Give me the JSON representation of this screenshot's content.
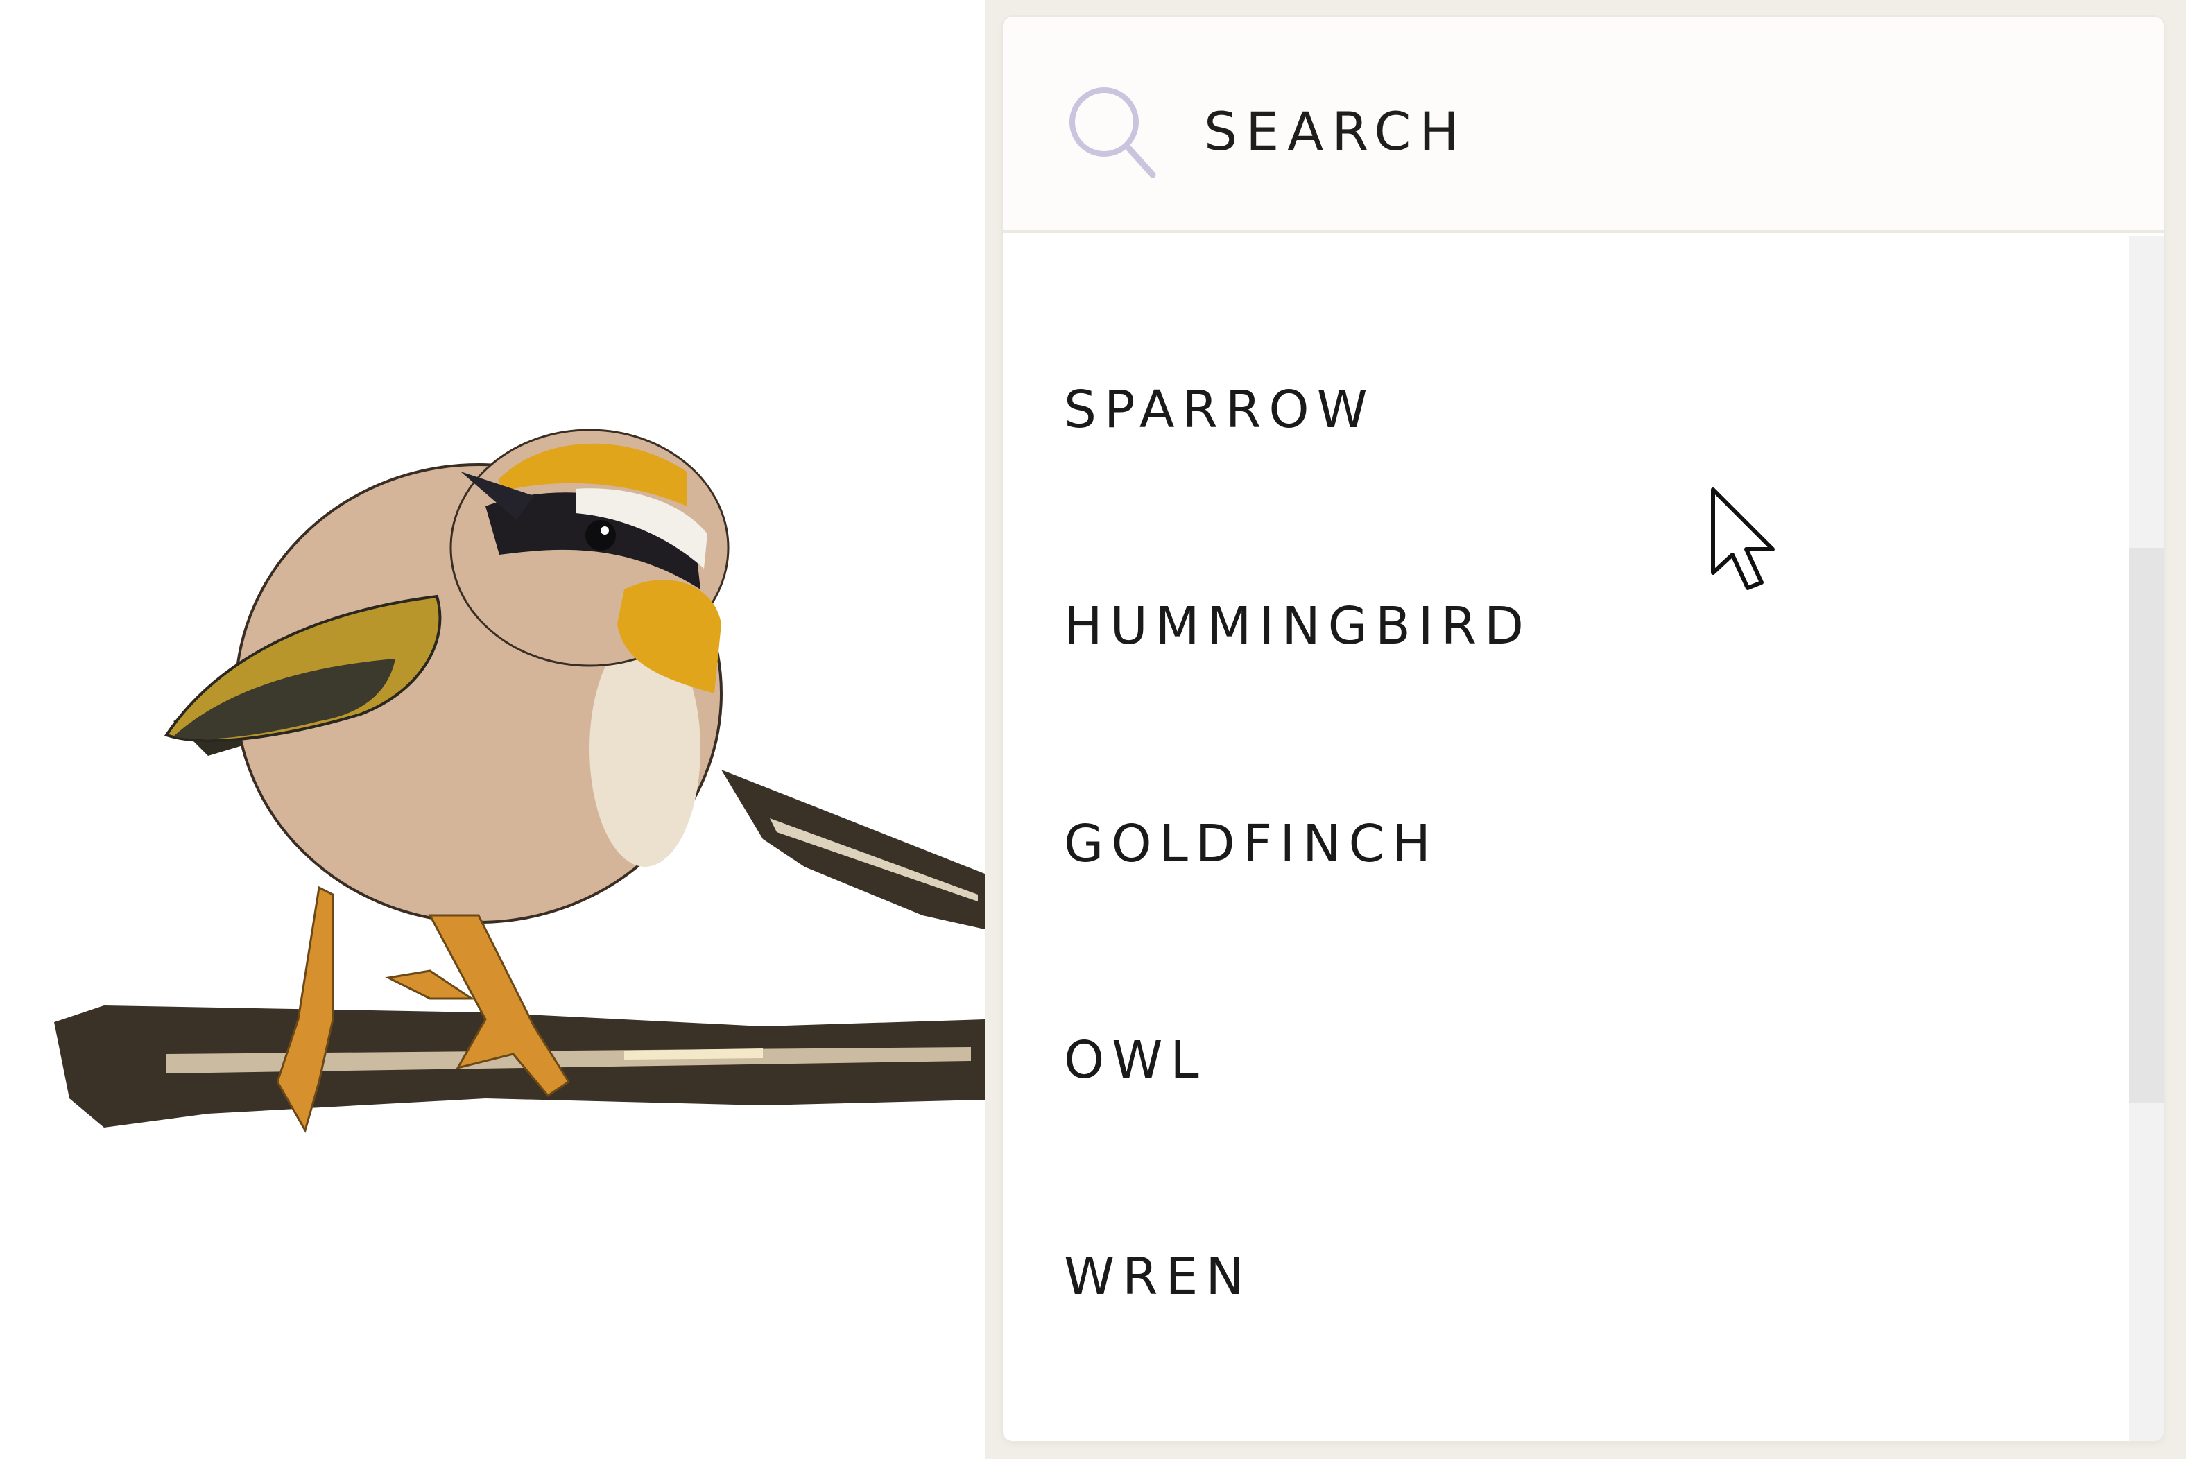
{
  "search": {
    "placeholder": "SEARCH",
    "value": ""
  },
  "list": {
    "items": [
      {
        "label": "SPARROW"
      },
      {
        "label": "HUMMINGBIRD"
      },
      {
        "label": "GOLDFINCH"
      },
      {
        "label": "OWL"
      },
      {
        "label": "WREN"
      }
    ]
  },
  "icons": {
    "search": "search-icon",
    "cursor": "mouse-pointer-icon"
  },
  "colors": {
    "side_background": "#f1ede7",
    "search_icon": "#c9c5de",
    "text": "#1a1a1a",
    "bird_crown": "#e1a51c",
    "bird_body": "#d4b59a"
  }
}
